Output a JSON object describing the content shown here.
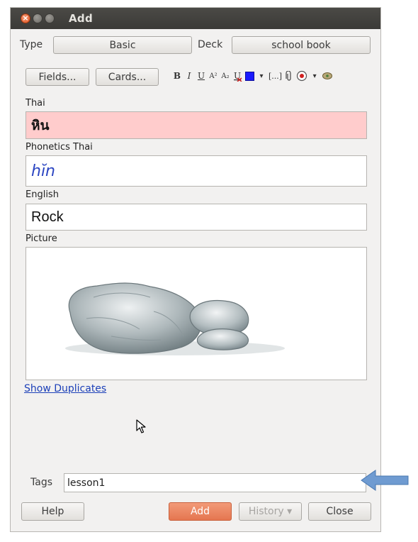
{
  "window": {
    "title": "Add"
  },
  "type_row": {
    "type_label": "Type",
    "type_value": "Basic",
    "deck_label": "Deck",
    "deck_value": "school book"
  },
  "buttons": {
    "fields": "Fields...",
    "cards": "Cards..."
  },
  "toolbar": {
    "bold": "B",
    "italic": "I",
    "underline": "U",
    "superscript": "A²",
    "subscript": "A₂",
    "text_color_dropdown": "▾",
    "cloze": "[...]",
    "record_dropdown": "▾",
    "text_color": "#1a1aff",
    "record_color": "#d02020"
  },
  "fields": [
    {
      "label": "Thai",
      "value": "หิน"
    },
    {
      "label": "Phonetics Thai",
      "value": "hĭn"
    },
    {
      "label": "English",
      "value": "Rock"
    },
    {
      "label": "Picture"
    }
  ],
  "show_duplicates": "Show Duplicates",
  "tags": {
    "label": "Tags",
    "value": "lesson1"
  },
  "footer": {
    "help": "Help",
    "add": "Add",
    "history": "History ▾",
    "close": "Close"
  },
  "colors": {
    "accent": "#e57650",
    "thai_field_bg": "#ffcccc",
    "phonetic_text": "#2b45c2",
    "link": "#1b3fb8",
    "annotation_arrow": "#6f9bd1"
  }
}
